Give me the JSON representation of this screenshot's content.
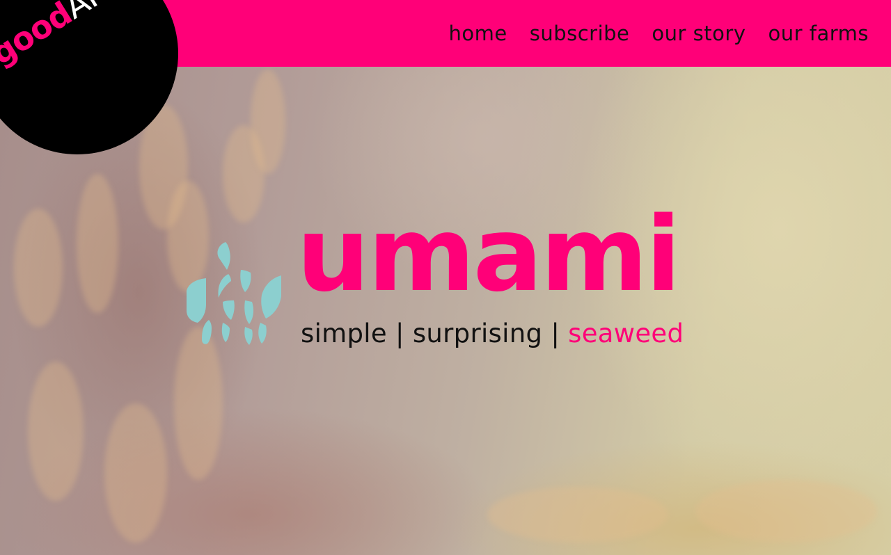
{
  "logo": {
    "part1": "good",
    "part2": "AF"
  },
  "nav": {
    "items": [
      {
        "label": "home"
      },
      {
        "label": "subscribe"
      },
      {
        "label": "our story"
      },
      {
        "label": "our farms"
      }
    ]
  },
  "hero": {
    "brand_name": "umami",
    "tagline": {
      "word1": "simple",
      "separator": "|",
      "word2": "surprising",
      "word3": "seaweed"
    }
  },
  "colors": {
    "accent": "#ff0078",
    "logo_bg": "#000000",
    "icon_teal": "#8ccfcf",
    "text_dark": "#111111"
  },
  "icons": {
    "brand_icon": "seaweed-leaf-icon"
  }
}
